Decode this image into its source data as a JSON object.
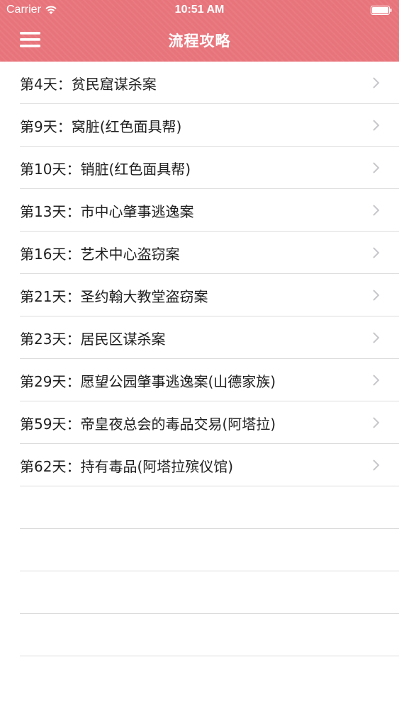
{
  "status_bar": {
    "carrier": "Carrier",
    "time": "10:51 AM"
  },
  "nav": {
    "title": "流程攻略",
    "menu_icon": "hamburger-menu-icon"
  },
  "items": [
    {
      "label": "第4天：贫民窟谋杀案"
    },
    {
      "label": "第9天：窝脏(红色面具帮)"
    },
    {
      "label": "第10天：销脏(红色面具帮)"
    },
    {
      "label": "第13天：市中心肇事逃逸案"
    },
    {
      "label": "第16天：艺术中心盗窃案"
    },
    {
      "label": "第21天：圣约翰大教堂盗窃案"
    },
    {
      "label": "第23天：居民区谋杀案"
    },
    {
      "label": "第29天：愿望公园肇事逃逸案(山德家族)"
    },
    {
      "label": "第59天：帝皇夜总会的毒品交易(阿塔拉)"
    },
    {
      "label": "第62天：持有毒品(阿塔拉殡仪馆)"
    }
  ],
  "colors": {
    "header": "#e8747b",
    "separator": "#dcdcdc",
    "chevron": "#c7c7cc"
  }
}
